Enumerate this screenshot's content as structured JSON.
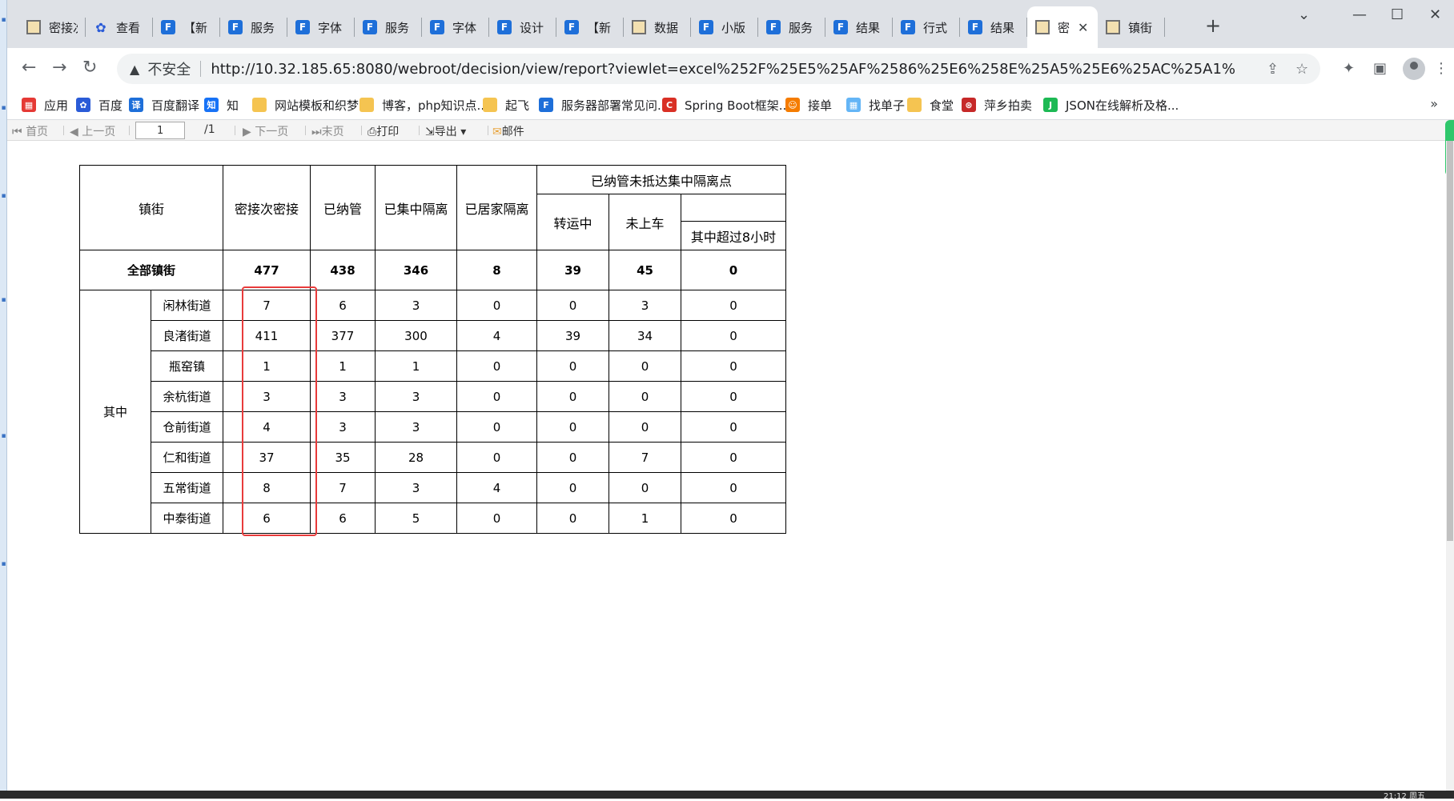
{
  "tabs": [
    {
      "title": "密接次",
      "favicon": "image-icon"
    },
    {
      "title": "查看",
      "favicon": "paw-icon"
    },
    {
      "title": "【新",
      "favicon": "fr-icon"
    },
    {
      "title": "服务",
      "favicon": "fr-icon"
    },
    {
      "title": "字体",
      "favicon": "fr-icon"
    },
    {
      "title": "服务",
      "favicon": "fr-icon"
    },
    {
      "title": "字体",
      "favicon": "fr-icon"
    },
    {
      "title": "设计",
      "favicon": "fr-icon"
    },
    {
      "title": "【新",
      "favicon": "fr-icon"
    },
    {
      "title": "数据",
      "favicon": "image-icon"
    },
    {
      "title": "小版",
      "favicon": "fr-icon"
    },
    {
      "title": "服务",
      "favicon": "fr-icon"
    },
    {
      "title": "结果",
      "favicon": "fr-icon"
    },
    {
      "title": "行式",
      "favicon": "fr-icon"
    },
    {
      "title": "结果",
      "favicon": "fr-icon"
    },
    {
      "title": "密",
      "favicon": "image-icon",
      "active": true
    },
    {
      "title": "镇街",
      "favicon": "image-icon"
    }
  ],
  "address": {
    "security_label": "不安全",
    "url_host": "http://10.32.185.65",
    "url_rest": ":8080/webroot/decision/view/report?viewlet=excel%252F%25E5%25AF%2586%25E6%258E%25A5%25E6%25AC%25A1%25E5%25AF%..."
  },
  "bookmarks": [
    {
      "label": "应用",
      "color": "#e53935"
    },
    {
      "label": "百度",
      "color": "#2a5bd7"
    },
    {
      "label": "百度翻译",
      "color": "#1e6fd9"
    },
    {
      "label": "知",
      "color": "#1772f6"
    },
    {
      "label": "网站模板和织梦",
      "color": "#f5c451"
    },
    {
      "label": "博客，php知识点...",
      "color": "#f5c451"
    },
    {
      "label": "起飞",
      "color": "#f5c451"
    },
    {
      "label": "服务器部署常见问...",
      "color": "#1e6fd9"
    },
    {
      "label": "Spring Boot框架...",
      "color": "#d93025"
    },
    {
      "label": "接单",
      "color": "#f57c00"
    },
    {
      "label": "找单子",
      "color": "#64b5f6"
    },
    {
      "label": "食堂",
      "color": "#f5c451"
    },
    {
      "label": "萍乡拍卖",
      "color": "#c62828"
    },
    {
      "label": "JSON在线解析及格...",
      "color": "#1db954"
    }
  ],
  "report_toolbar": {
    "first": "首页",
    "prev": "上一页",
    "page_value": "1",
    "page_total": "/1",
    "next": "下一页",
    "last": "末页",
    "print": "打印",
    "export": "导出",
    "mail": "邮件"
  },
  "table": {
    "headers": {
      "town": "镇街",
      "contacts": "密接次密接",
      "managed": "已纳管",
      "centralized": "已集中隔离",
      "home": "已居家隔离",
      "not_arrived_group": "已纳管未抵达集中隔离点",
      "in_transit": "转运中",
      "not_boarded": "未上车",
      "over_8h": "其中超过8小时"
    },
    "total": {
      "label": "全部镇街",
      "values": [
        "477",
        "438",
        "346",
        "8",
        "39",
        "45",
        "0"
      ]
    },
    "group_label": "其中",
    "rows": [
      {
        "name": "闲林街道",
        "values": [
          "7",
          "6",
          "3",
          "0",
          "0",
          "3",
          "0"
        ]
      },
      {
        "name": "良渚街道",
        "values": [
          "411",
          "377",
          "300",
          "4",
          "39",
          "34",
          "0"
        ]
      },
      {
        "name": "瓶窑镇",
        "values": [
          "1",
          "1",
          "1",
          "0",
          "0",
          "0",
          "0"
        ]
      },
      {
        "name": "余杭街道",
        "values": [
          "3",
          "3",
          "3",
          "0",
          "0",
          "0",
          "0"
        ]
      },
      {
        "name": "仓前街道",
        "values": [
          "4",
          "3",
          "3",
          "0",
          "0",
          "0",
          "0"
        ]
      },
      {
        "name": "仁和街道",
        "values": [
          "37",
          "35",
          "28",
          "0",
          "0",
          "7",
          "0"
        ]
      },
      {
        "name": "五常街道",
        "values": [
          "8",
          "7",
          "3",
          "4",
          "0",
          "0",
          "0"
        ]
      },
      {
        "name": "中泰街道",
        "values": [
          "6",
          "6",
          "5",
          "0",
          "0",
          "1",
          "0"
        ]
      }
    ]
  },
  "taskbar": {
    "clock": "21:12 周五"
  }
}
